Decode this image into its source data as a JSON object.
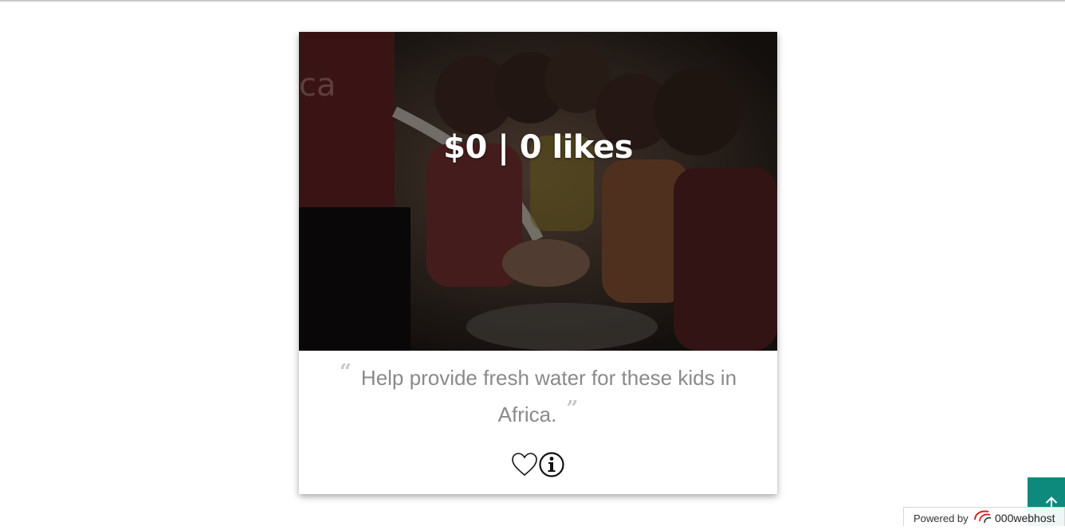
{
  "campaign": {
    "headline": "$0 | 0 likes",
    "description": "Help provide fresh water for these kids in Africa.",
    "quote_open": "“",
    "quote_close": "”",
    "photo_description": "children-at-water-tap",
    "like_icon": "heart-outline-icon",
    "info_icon": "info-circle-icon"
  },
  "footer": {
    "powered_label": "Powered by",
    "brand_name": "000webhost",
    "scroll_top_icon": "arrow-up-icon",
    "scroll_top_color": "#0e8a7c"
  }
}
